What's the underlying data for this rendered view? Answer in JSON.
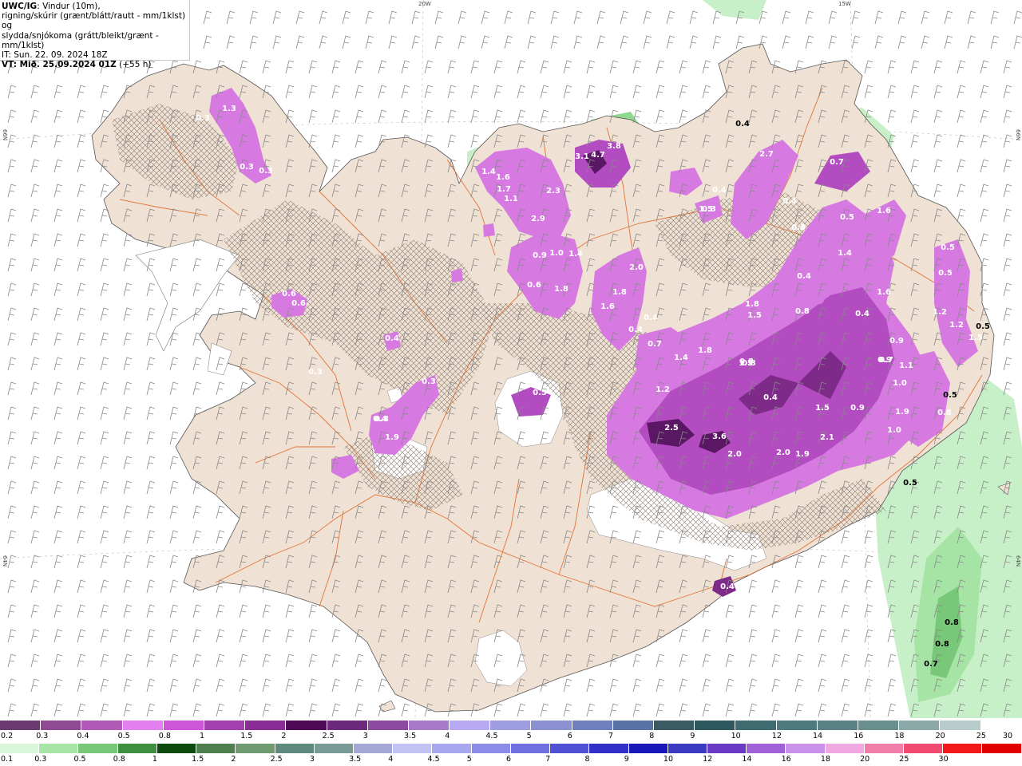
{
  "header": {
    "model": "UWC/IG",
    "line1_rest": ": Vindur (10m),",
    "line2": "rigning/skúrir (grænt/blátt/rautt - mm/1klst) og",
    "line3": "slydda/snjókoma (grátt/bleikt/grænt - mm/1klst)",
    "init_time": "IT: Sun. 22. 09. 2024 18Z",
    "valid_label": "VT: Mið. 25.09.2024 01Z",
    "lead": "(+55 h)"
  },
  "coords": {
    "top_left": "20W",
    "top_right": "15W",
    "left_upper": "66N",
    "left_lower": "64N",
    "right_upper": "66N",
    "right_lower": "64N"
  },
  "colors": {
    "land": "#efe1d3",
    "sea": "#ffffff",
    "roads": "#e0601e",
    "rain_light": "#c8f0c8",
    "rain_mid": "#8ed98e",
    "snow_dark": "#6a2e72",
    "snow_mid": "#b23dc0",
    "snow_light": "#e58cf0",
    "snow_pale": "#f3b6f8"
  },
  "map_values": {
    "magenta": [
      "1.3",
      "0.3",
      "0.3",
      "0.3",
      "0.6",
      "0.4",
      "0.3",
      "0.4",
      "0.8",
      "1.9",
      "0.3",
      "0.5",
      "0.6",
      "1.4",
      "1.6",
      "1.7",
      "1.1",
      "2.9",
      "2.3",
      "4.7",
      "3.8",
      "3.1",
      "1.0",
      "0.9",
      "1.4",
      "0.6",
      "1.8",
      "1.6",
      "1.8",
      "2.0",
      "0.4",
      "0.4",
      "0.7",
      "1.4",
      "1.8",
      "1.2",
      "2.5",
      "3.6",
      "2.0",
      "2.0",
      "1.9",
      "2.1",
      "1.5",
      "0.9",
      "0.9",
      "1.5",
      "1.8",
      "0.8",
      "1.5",
      "0.4",
      "0.3",
      "0.3",
      "0.4",
      "1.5",
      "2.7",
      "0.7",
      "0.4",
      "0.3",
      "0.4",
      "0.8",
      "1.6",
      "1.4",
      "0.5",
      "0.4",
      "1.6",
      "1.0",
      "1.9",
      "0.5",
      "0.5",
      "1.2",
      "1.2",
      "1.5",
      "0.9",
      "1.1",
      "1.0",
      "0.8",
      "0.4",
      "0.7",
      "0.4"
    ],
    "green": [
      "0.8",
      "0.8",
      "0.7",
      "0.5",
      "0.5",
      "0.5",
      "0.4"
    ]
  },
  "scale_snow": {
    "colors": [
      "#6b3a6e",
      "#8f4a93",
      "#b25ab8",
      "#e47fef",
      "#cc55d8",
      "#a640b2",
      "#8a2d96",
      "#4e0a55",
      "#6d2a7c",
      "#8c4aa0",
      "#a67ac8",
      "#b7aaf2",
      "#9d9ddf",
      "#8a90d0",
      "#6e7fbe",
      "#5a73a6",
      "#3b5a61",
      "#2e5860",
      "#3d6b70",
      "#4d7a7d",
      "#5a8284",
      "#688e8e",
      "#8aa8a6",
      "#b7cccb",
      "#ffffff"
    ],
    "labels": [
      "0.2",
      "0.3",
      "0.4",
      "0.5",
      "0.8",
      "1",
      "1.5",
      "2",
      "2.5",
      "3",
      "3.5",
      "4",
      "4.5",
      "5",
      "6",
      "7",
      "8",
      "9",
      "10",
      "12",
      "14",
      "16",
      "18",
      "20",
      "25",
      "30"
    ]
  },
  "scale_rain": {
    "colors": [
      "#d8f7d8",
      "#a8e6a8",
      "#78c878",
      "#3f8f3f",
      "#0d4a0d",
      "#4f7f4f",
      "#6f9a6f",
      "#5e8a7e",
      "#7a9a96",
      "#a4a8d4",
      "#c2c2f4",
      "#a8a8f0",
      "#8c8ce8",
      "#7070e0",
      "#5050d4",
      "#3030c8",
      "#1818b8",
      "#3a3ac0",
      "#6a3ac4",
      "#a060d8",
      "#c890e8",
      "#f0a8e0",
      "#f07ca8",
      "#f04a70",
      "#f01818",
      "#e00000"
    ],
    "labels": [
      "0.1",
      "0.3",
      "0.5",
      "0.8",
      "1",
      "1.5",
      "2",
      "2.5",
      "3",
      "3.5",
      "4",
      "4.5",
      "5",
      "6",
      "7",
      "8",
      "9",
      "10",
      "12",
      "14",
      "16",
      "18",
      "20",
      "25",
      "30"
    ]
  }
}
